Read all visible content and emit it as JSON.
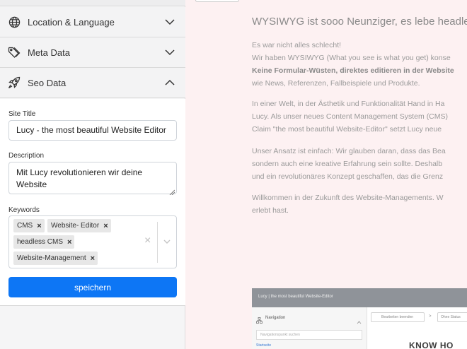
{
  "sidebar": {
    "sections": [
      {
        "label": "Location & Language",
        "icon": "globe-icon",
        "expanded": false
      },
      {
        "label": "Meta Data",
        "icon": "tag-icon",
        "expanded": false
      },
      {
        "label": "Seo Data",
        "icon": "rocket-icon",
        "expanded": true
      }
    ],
    "seo": {
      "site_title_label": "Site Title",
      "site_title_value": "Lucy - the most beautiful Website Editor",
      "description_label": "Description",
      "description_line1": "Mit Lucy revolutionieren wir deine",
      "description_line2": "Website",
      "keywords_label": "Keywords",
      "keywords": [
        "CMS",
        "Website- Editor",
        "headless CMS",
        "Website-Management"
      ],
      "save_label": "speichern"
    }
  },
  "content": {
    "title": "WYSIWYG ist sooo Neunziger, es lebe headless",
    "p1": {
      "l1": "Es war nicht alles schlecht!",
      "l2": "Wir haben WYSIWYG (What you see is what you get) konse",
      "l3": "Keine Formular-Wüsten, direktes editieren in der Website",
      "l4": "wie News, Referenzen, Fallbeispiele und Produkte."
    },
    "p2": {
      "l1": "In einer Welt, in der Ästhetik und Funktionalität Hand in Ha",
      "l2": "Lucy. Als unser neues Content Management System (CMS)",
      "l3": "Claim \"the most beautiful Website-Editor\" setzt Lucy neue"
    },
    "p3": {
      "l1": "Unser Ansatz ist einfach: Wir glauben daran, dass das Bea",
      "l2": "sondern auch eine kreative Erfahrung sein sollte. Deshalb",
      "l3": "und ein revolutionäres Konzept geschaffen, das die Grenz"
    },
    "p4": {
      "l1": "Willkommen in der Zukunft des Website-Managements. W",
      "l2": "erlebt hast."
    }
  },
  "preview": {
    "bar_title": "Lucy | the most beautiful Website-Editor",
    "nav_label": "Navigation",
    "search_placeholder": "Navigationspunkt suchen",
    "start_item": "Startseite",
    "edit_button": "Bearbeiten beenden",
    "separator": ">",
    "status_button": "Ohne Status",
    "heading": "KNOW HO"
  },
  "colors": {
    "primary": "#0d76f5",
    "content_bg": "#fdf1f2",
    "sidebar_bg": "#f5f5f6"
  }
}
